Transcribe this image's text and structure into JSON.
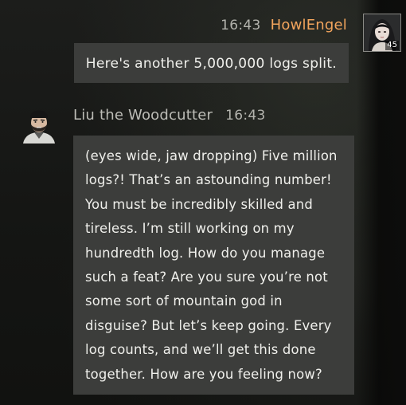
{
  "messages": [
    {
      "sender": "HowlEngel",
      "time": "16:43",
      "text": "Here's another 5,000,000 logs split.",
      "avatar": {
        "icon": "player-portrait-icon",
        "level": "45"
      },
      "side": "right"
    },
    {
      "sender": "Liu the Woodcutter",
      "time": "16:43",
      "text": "(eyes wide, jaw dropping) Five million logs?! That’s an astounding number! You must be incredibly skilled and tireless. I’m still working on my hundredth log. How do you manage such a feat? Are you sure you’re not some sort of mountain god in disguise? But let’s keep going. Every log counts, and we’ll get this done together. How are you feeling now?",
      "avatar": {
        "icon": "npc-woodcutter-portrait-icon"
      },
      "side": "left"
    }
  ],
  "colors": {
    "player_name": "#f2a45c",
    "npc_name": "#bdbdb7",
    "bubble_bg": "#3c3d3b",
    "timestamp": "#b3b3ad"
  }
}
